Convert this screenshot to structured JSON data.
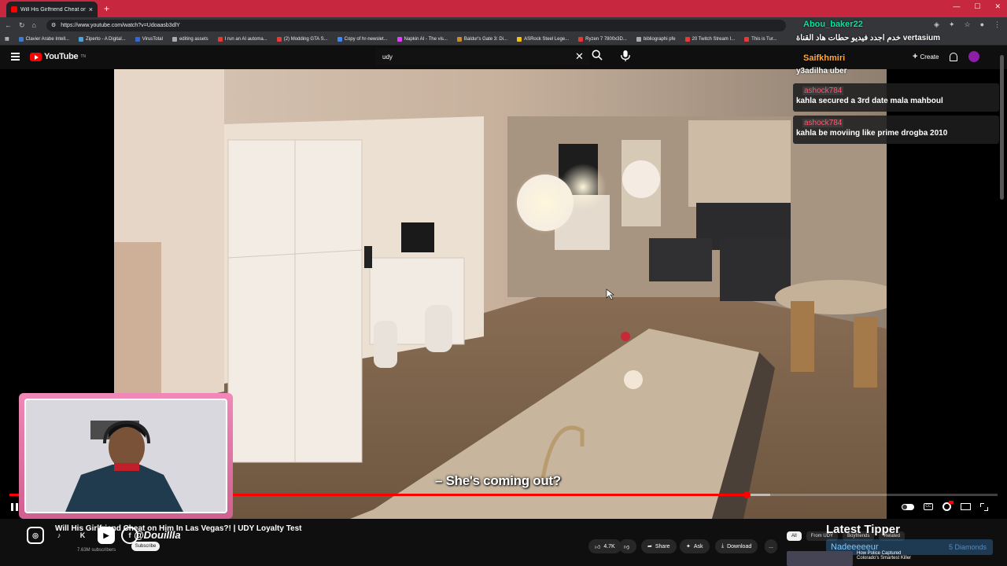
{
  "browser": {
    "tab_title": "Will His Girlfriend Cheat on H...",
    "new_tab": "+",
    "url": "https://www.youtube.com/watch?v=Udoaasb3dlY",
    "bookmarks": [
      {
        "label": "Clavier Arabe Intell...",
        "color": "#3b7bd4"
      },
      {
        "label": "Ziperto - A Digital...",
        "color": "#4aa3df"
      },
      {
        "label": "VirusTotal",
        "color": "#3367d6"
      },
      {
        "label": "editing assets",
        "color": "#aaaaaa"
      },
      {
        "label": "I run an AI automa...",
        "color": "#e53935"
      },
      {
        "label": "(2) Modding GTA S...",
        "color": "#e53935"
      },
      {
        "label": "Copy of hr-newslet...",
        "color": "#4285f4"
      },
      {
        "label": "Napkin AI - The vis...",
        "color": "#e040fb"
      },
      {
        "label": "Baldur's Gate 3: Di...",
        "color": "#c58b2c"
      },
      {
        "label": "ASRock Steel Lege...",
        "color": "#f4c20d"
      },
      {
        "label": "Ryzen 7 7800x3D...",
        "color": "#e53935"
      },
      {
        "label": "bibliographi pfe",
        "color": "#aaaaaa"
      },
      {
        "label": "20 Twitch Stream I...",
        "color": "#e53935"
      },
      {
        "label": "This is Tur...",
        "color": "#e53935"
      }
    ]
  },
  "youtube": {
    "logo": "YouTube",
    "logo_sup": "TN",
    "search_value": "udy",
    "create_label": "Create"
  },
  "chat": {
    "top_user": "Abou_baker22",
    "top_message": "خدم اجدد فيديو حطات هاد القناة vertasium",
    "user2": "Saifkhmiri",
    "user2_message": "y3adilha uber",
    "cards": [
      {
        "user": "ashock784",
        "message": "kahla secured a 3rd date mala mahboul"
      },
      {
        "user": "ashock784",
        "message": "kahla be moviing like prime drogba 2010"
      }
    ]
  },
  "player": {
    "subtitle": "– She's coming out?",
    "progress": 0.746,
    "buffered": 0.77
  },
  "below": {
    "video_title": "Will His Girlfriend Cheat on Him In Las Vegas?! | UDY Loyalty Test",
    "handle": "@Douillla",
    "subscribers": "7.63M subscribers",
    "subscribe": "Subscribe",
    "likes": "4.7K",
    "share": "Share",
    "ask": "Ask",
    "download": "Download",
    "more": "...",
    "chips": [
      "All",
      "From UDY",
      "Boyfriends",
      "Related"
    ],
    "related_title": "How Police Captured Colorado's Smartest Killer",
    "latest_tipper_label": "Latest Tipper",
    "tipper_name": "Nadeeeeeur",
    "tipper_amount": "5 Diamonds"
  }
}
